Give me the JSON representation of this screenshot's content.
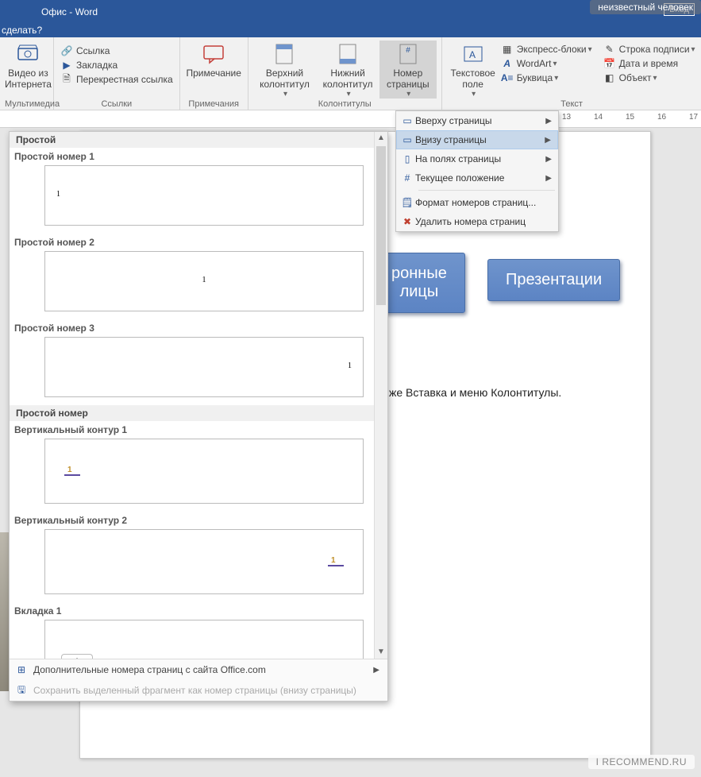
{
  "title": "Офис  -  Word",
  "login": "Вход",
  "overlay": "неизвестный человек",
  "help": "сделать?",
  "ribbon": {
    "multimedia": {
      "video": "Видео из Интернета",
      "label": "Мультимедиа"
    },
    "links": {
      "link": "Ссылка",
      "bookmark": "Закладка",
      "cross": "Перекрестная ссылка",
      "label": "Ссылки"
    },
    "comments": {
      "btn": "Примечание",
      "label": "Примечания"
    },
    "hf": {
      "header": "Верхний колонтитул",
      "footer": "Нижний колонтитул",
      "pagenum": "Номер страницы",
      "label": "Колонтитулы"
    },
    "textgrp": {
      "textbox": "Текстовое поле",
      "quick": "Экспресс-блоки",
      "wordart": "WordArt",
      "dropcap": "Буквица",
      "sig": "Строка подписи",
      "date": "Дата и время",
      "object": "Объект",
      "label": "Текст"
    }
  },
  "ctx": {
    "top": "Вверху страницы",
    "bottom_pre": "В",
    "bottom_u": "н",
    "bottom_post": "изу страницы",
    "margins": "На полях страницы",
    "current": "Текущее положение",
    "format": "Формат номеров страниц...",
    "remove": "Удалить номера страниц"
  },
  "gallery": {
    "group1": "Простой",
    "i1": "Простой номер 1",
    "i2": "Простой номер 2",
    "i3": "Простой номер 3",
    "group2": "Простой номер",
    "v1": "Вертикальный контур 1",
    "v2": "Вертикальный контур 2",
    "tab": "Вкладка 1",
    "more": "Дополнительные номера страниц с сайта Office.com",
    "save": "Сохранить выделенный фрагмент как номер страницы (внизу страницы)"
  },
  "doc": {
    "box1_suffix": "ронные",
    "box1_line2": "лицы",
    "box2": "Презентации",
    "text_suffix": "же Вставка и меню Колонтитулы."
  },
  "ruler_marks": [
    "13",
    "14",
    "15",
    "16",
    "17"
  ],
  "watermark": "I RECOMMEND.RU"
}
